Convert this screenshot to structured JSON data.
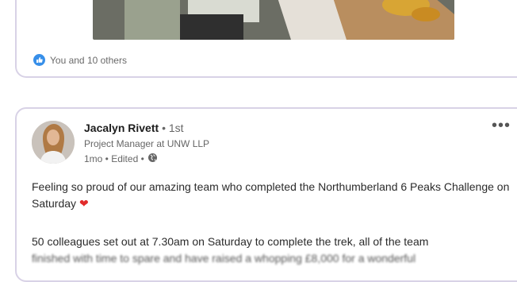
{
  "previous_post": {
    "reactions_text": "You and 10 others"
  },
  "post": {
    "author_name": "Jacalyn Rivett",
    "degree": "• 1st",
    "headline": "Project Manager at UNW LLP",
    "meta_time": "1mo • Edited •",
    "more_label": "•••",
    "text_line1": "Feeling so proud of our amazing team who completed the Northumberland 6 Peaks Challenge on Saturday",
    "heart": "❤",
    "text_line2": "50 colleagues set out at 7.30am on Saturday to complete the trek, all of the team",
    "text_line3": "finished with time to spare and have raised a whopping £8,000 for a wonderful"
  },
  "colors": {
    "like_blue": "#378fe9",
    "heart_red": "#e12b2b",
    "card_border": "#d8d2e6"
  },
  "icons": {
    "like": "like-icon",
    "globe": "globe-icon",
    "more": "more-options-icon"
  }
}
